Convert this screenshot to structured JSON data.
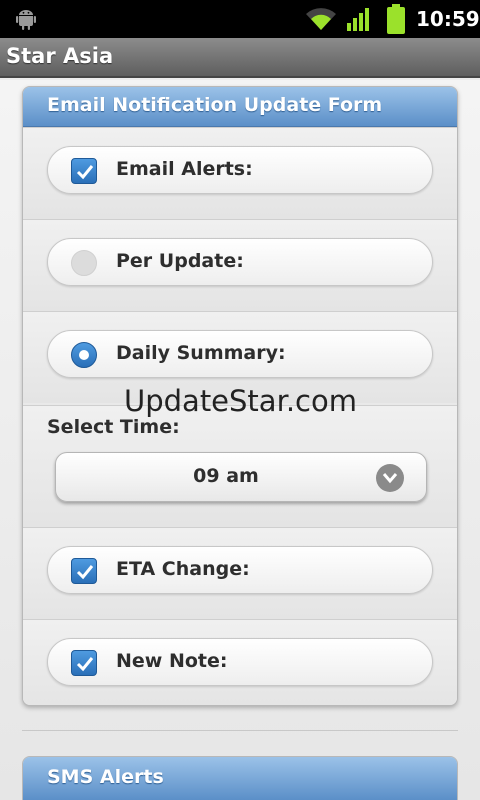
{
  "status_bar": {
    "time": "10:59",
    "icons": [
      "android-icon",
      "wifi-icon",
      "signal-icon",
      "battery-icon"
    ],
    "battery_color": "#9be12b"
  },
  "app": {
    "title": "Star Asia"
  },
  "email_form": {
    "title": "Email Notification Update Form",
    "header_color": "#5b8fc8",
    "email_alerts": {
      "label": "Email Alerts:",
      "checked": true
    },
    "per_update": {
      "label": "Per Update:",
      "selected": false
    },
    "daily_summary": {
      "label": "Daily Summary:",
      "selected": true
    },
    "select_time": {
      "label": "Select Time:",
      "value": "09 am"
    },
    "eta_change": {
      "label": "ETA Change:",
      "checked": true
    },
    "new_note": {
      "label": "New Note:",
      "checked": true
    }
  },
  "watermark": "UpdateStar.com",
  "sms_section": {
    "title": "SMS Alerts"
  }
}
